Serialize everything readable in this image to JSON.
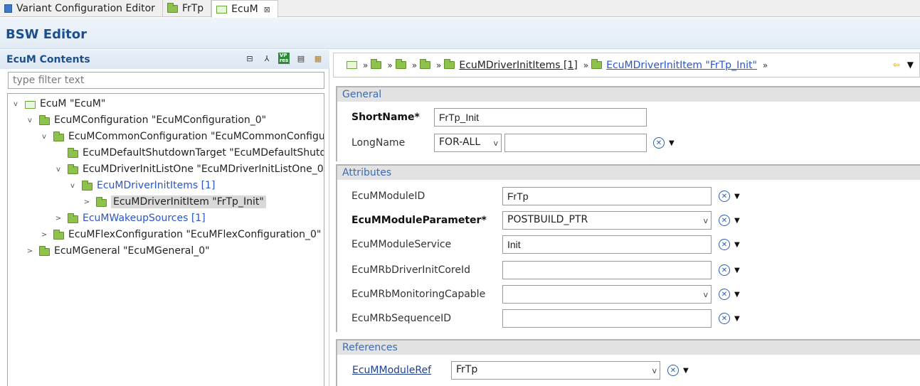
{
  "tabs": [
    {
      "label": "Variant Configuration Editor",
      "icon": "editor-icon"
    },
    {
      "label": "FrTp",
      "icon": "folder-icon"
    },
    {
      "label": "EcuM",
      "icon": "module-icon",
      "close": "⊠"
    }
  ],
  "editor": {
    "title": "BSW Editor"
  },
  "left_panel": {
    "title": "EcuM Contents",
    "filter_placeholder": "type filter text",
    "toolbar": [
      "collapse-all-icon",
      "link-icon",
      "vp-res-icon",
      "document-icon",
      "table-icon"
    ]
  },
  "tree": [
    {
      "label": "EcuM \"EcuM\"",
      "level": 0,
      "expanded": true,
      "icon": "module-icon"
    },
    {
      "label": "EcuMConfiguration \"EcuMConfiguration_0\"",
      "level": 1,
      "expanded": true,
      "icon": "folder-icon"
    },
    {
      "label": "EcuMCommonConfiguration \"EcuMCommonConfigura",
      "level": 2,
      "expanded": true,
      "icon": "folder-icon"
    },
    {
      "label": "EcuMDefaultShutdownTarget \"EcuMDefaultShutdov",
      "level": 3,
      "icon": "folder-icon"
    },
    {
      "label": "EcuMDriverInitListOne \"EcuMDriverInitListOne_0\"",
      "level": 3,
      "expanded": true,
      "icon": "folder-icon"
    },
    {
      "label": "EcuMDriverInitItems [1]",
      "level": 4,
      "expanded": true,
      "icon": "folder-icon",
      "link": true
    },
    {
      "label": "EcuMDriverInitItem \"FrTp_Init\"",
      "level": 5,
      "collapsed": true,
      "icon": "folder-icon",
      "selected": true
    },
    {
      "label": "EcuMWakeupSources [1]",
      "level": 3,
      "collapsed": true,
      "icon": "folder-icon",
      "link": true
    },
    {
      "label": "EcuMFlexConfiguration \"EcuMFlexConfiguration_0\"",
      "level": 2,
      "collapsed": true,
      "icon": "folder-icon"
    },
    {
      "label": "EcuMGeneral \"EcuMGeneral_0\"",
      "level": 1,
      "collapsed": true,
      "icon": "folder-icon"
    }
  ],
  "breadcrumb": {
    "items": [
      "EcuMDriverInitItems [1]",
      "EcuMDriverInitItem \"FrTp_Init\""
    ]
  },
  "general": {
    "title": "General",
    "shortname_label": "ShortName*",
    "shortname_value": "FrTp_Init",
    "longname_label": "LongName",
    "longname_lang": "FOR-ALL",
    "longname_value": ""
  },
  "attributes": {
    "title": "Attributes",
    "rows": [
      {
        "label": "EcuMModuleID",
        "value": "FrTp",
        "type": "text"
      },
      {
        "label": "EcuMModuleParameter*",
        "value": "POSTBUILD_PTR",
        "type": "select",
        "bold": true
      },
      {
        "label": "EcuMModuleService",
        "value": "Init",
        "type": "text"
      },
      {
        "label": "EcuMRbDriverInitCoreId",
        "value": "",
        "type": "text"
      },
      {
        "label": "EcuMRbMonitoringCapable",
        "value": "",
        "type": "select"
      },
      {
        "label": "EcuMRbSequenceID",
        "value": "",
        "type": "text"
      }
    ]
  },
  "references": {
    "title": "References",
    "rows": [
      {
        "label": "EcuMModuleRef",
        "value": "FrTp",
        "type": "select"
      }
    ]
  },
  "colors": {
    "accent": "#1c4f8c",
    "link": "#2a56c6",
    "folder": "#8fc24c"
  }
}
